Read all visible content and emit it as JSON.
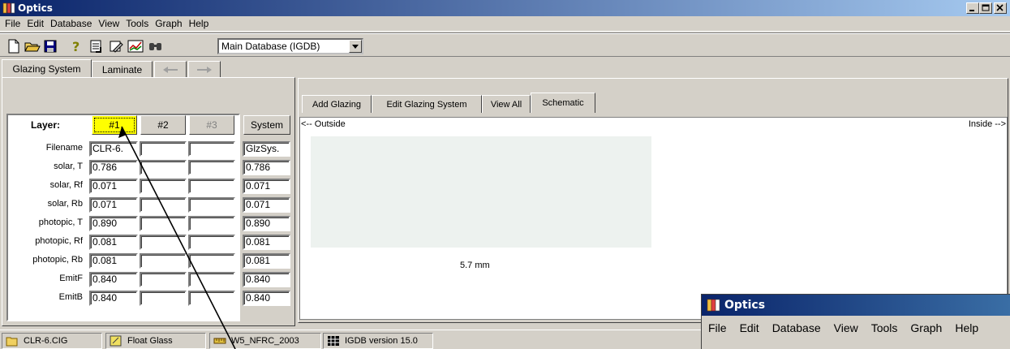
{
  "window": {
    "title": "Optics"
  },
  "menu": [
    {
      "label": "File"
    },
    {
      "label": "Edit"
    },
    {
      "label": "Database"
    },
    {
      "label": "View"
    },
    {
      "label": "Tools"
    },
    {
      "label": "Graph"
    },
    {
      "label": "Help"
    }
  ],
  "toolbar": {
    "icons": [
      "new-file-icon",
      "open-folder-icon",
      "save-icon",
      "help-icon",
      "report-icon",
      "edit-icon",
      "chart-icon",
      "find-icon"
    ],
    "database_select": "Main Database (IGDB)"
  },
  "left_tabs": [
    {
      "label": "Glazing System"
    },
    {
      "label": "Laminate"
    }
  ],
  "layers": {
    "header": "Layer:",
    "buttons": [
      "#1",
      "#2",
      "#3"
    ],
    "system_button": "System",
    "rows": [
      {
        "label": "Filename",
        "l1": "CLR-6.",
        "sys": "GlzSys."
      },
      {
        "label": "solar, T",
        "l1": "0.786",
        "sys": "0.786"
      },
      {
        "label": "solar, Rf",
        "l1": "0.071",
        "sys": "0.071"
      },
      {
        "label": "solar, Rb",
        "l1": "0.071",
        "sys": "0.071"
      },
      {
        "label": "photopic, T",
        "l1": "0.890",
        "sys": "0.890"
      },
      {
        "label": "photopic, Rf",
        "l1": "0.081",
        "sys": "0.081"
      },
      {
        "label": "photopic, Rb",
        "l1": "0.081",
        "sys": "0.081"
      },
      {
        "label": "EmitF",
        "l1": "0.840",
        "sys": "0.840"
      },
      {
        "label": "EmitB",
        "l1": "0.840",
        "sys": "0.840"
      }
    ]
  },
  "right_tabs": [
    {
      "label": "Add Glazing"
    },
    {
      "label": "Edit Glazing System"
    },
    {
      "label": "View All"
    },
    {
      "label": "Schematic"
    }
  ],
  "schematic": {
    "outside_label": "<-- Outside",
    "inside_label": "Inside -->",
    "thickness_label": "5.7 mm",
    "glass_color": "#edf2ef"
  },
  "status": [
    {
      "label": "CLR-6.CIG",
      "icon": "file-icon"
    },
    {
      "label": "Float Glass",
      "icon": "glass-icon"
    },
    {
      "label": "W5_NFRC_2003",
      "icon": "ruler-icon"
    },
    {
      "label": "IGDB version 15.0",
      "icon": "grid-icon"
    }
  ],
  "second_window": {
    "title": "Optics",
    "menu": [
      "File",
      "Edit",
      "Database",
      "View",
      "Tools",
      "Graph",
      "Help"
    ]
  },
  "colors": {
    "title_bar": "#0a246a",
    "face": "#d4d0c8",
    "selected_layer": "#ffff00"
  }
}
